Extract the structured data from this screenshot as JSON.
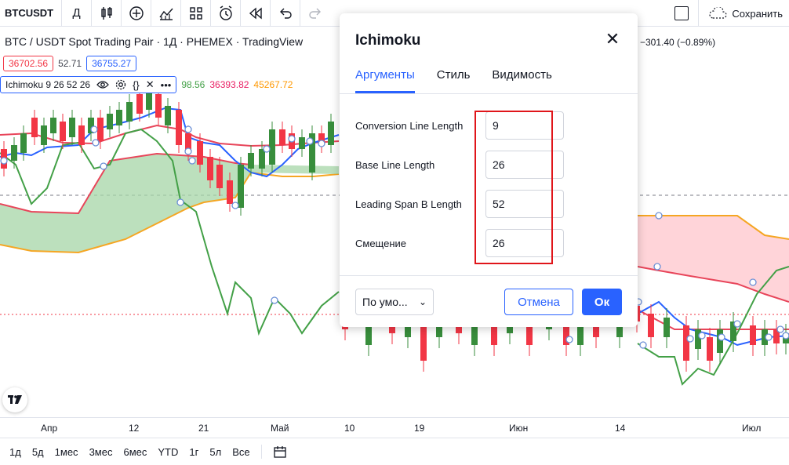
{
  "toolbar": {
    "symbol": "BTCUSDT",
    "interval": "Д",
    "save_label": "Сохранить",
    "icons": [
      "candles-icon",
      "add-indicator-icon",
      "indicators-icon",
      "layout-icon",
      "alert-icon",
      "replay-icon",
      "undo-icon",
      "redo-icon"
    ]
  },
  "chart": {
    "title": "BTC / USDT Spot Trading Pair · 1Д · PHEMEX · TradingView",
    "change": "−301.40 (−0.89%)",
    "sell_price": "36702.56",
    "spread": "52.71",
    "buy_price": "36755.27",
    "indicator": {
      "label": "Ichimoku 9 26 52 26",
      "values": [
        "98.56",
        "36393.82",
        "45267.72"
      ],
      "value_colors": [
        "#43a047",
        "#e91e63",
        "#ff9800"
      ]
    },
    "colors": {
      "up": "#26a69a",
      "up_alt": "#388e3c",
      "down": "#f23645",
      "conversion": "#2962ff",
      "base": "#e8455a",
      "lagging": "#43a047",
      "span_a": "#e8455a",
      "span_b": "#f5a623",
      "cloud_green": "#a5d6a7",
      "cloud_red": "#ffcdd2"
    }
  },
  "time_axis": [
    "Апр",
    "12",
    "21",
    "Май",
    "10",
    "19",
    "Июн",
    "14",
    "Июл"
  ],
  "ranges": [
    "1д",
    "5д",
    "1мес",
    "3мес",
    "6мес",
    "YTD",
    "1г",
    "5л",
    "Все"
  ],
  "dialog": {
    "title": "Ichimoku",
    "tabs": [
      "Аргументы",
      "Стиль",
      "Видимость"
    ],
    "active_tab": 0,
    "fields": [
      {
        "label": "Conversion Line Length",
        "value": "9"
      },
      {
        "label": "Base Line Length",
        "value": "26"
      },
      {
        "label": "Leading Span B Length",
        "value": "52"
      },
      {
        "label": "Смещение",
        "value": "26"
      }
    ],
    "defaults_label": "По умо...",
    "cancel_label": "Отмена",
    "ok_label": "Ок"
  }
}
